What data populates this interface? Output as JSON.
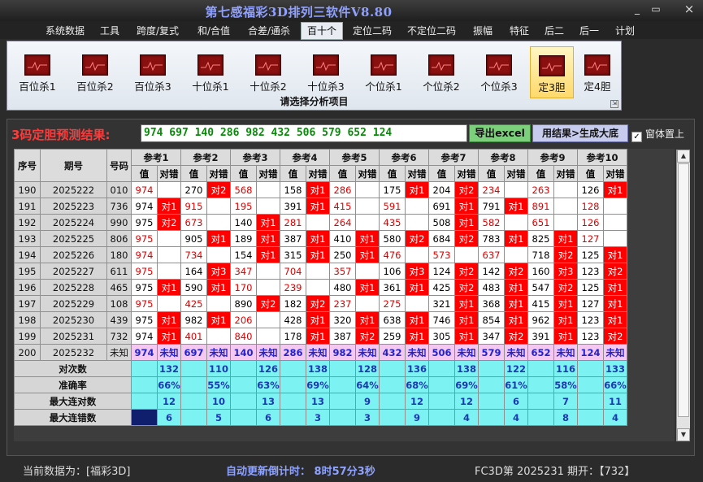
{
  "window": {
    "title": "第七感福彩3D排列三软件V8.80",
    "minimize_icon": "_",
    "restore_icon": "▭",
    "close_icon": "×"
  },
  "menu": [
    {
      "label": "系统数据"
    },
    {
      "label": "工具"
    },
    {
      "label": "跨度/复式"
    },
    {
      "label": "和/合值"
    },
    {
      "label": "合差/通杀"
    },
    {
      "label": "百十个"
    },
    {
      "label": "定位二码"
    },
    {
      "label": "不定位二码"
    },
    {
      "label": "振幅"
    },
    {
      "label": "特征"
    },
    {
      "label": "后二"
    },
    {
      "label": "后一"
    },
    {
      "label": "计划"
    }
  ],
  "ribbon": {
    "tools": [
      {
        "label": "百位杀1"
      },
      {
        "label": "百位杀2"
      },
      {
        "label": "百位杀3"
      },
      {
        "label": "十位杀1"
      },
      {
        "label": "十位杀2"
      },
      {
        "label": "十位杀3"
      },
      {
        "label": "个位杀1"
      },
      {
        "label": "个位杀2"
      },
      {
        "label": "个位杀3"
      },
      {
        "label": "定3胆"
      },
      {
        "label": "定4胆"
      }
    ],
    "caption": "请选择分析项目",
    "corner_icon": "⇲"
  },
  "result": {
    "label": "3码定胆预测结果:",
    "value": "974 697 140 286 982 432 506 579 652 124",
    "export_label": "导出excel",
    "filter_label": "用结果>生成大底",
    "ontop_label": "窗体置上",
    "ontop_mark": "✓"
  },
  "grid": {
    "headers": {
      "seq": "序号",
      "period": "期号",
      "code": "号码",
      "val": "值",
      "hit": "对错"
    },
    "refs": [
      "参考1",
      "参考2",
      "参考3",
      "参考4",
      "参考5",
      "参考6",
      "参考7",
      "参考8",
      "参考9",
      "参考10"
    ],
    "rows": [
      {
        "seq": "190",
        "period": "2025222",
        "code": "010",
        "cells": [
          [
            "974",
            ""
          ],
          [
            "270",
            "对2"
          ],
          [
            "568",
            ""
          ],
          [
            "158",
            "对1"
          ],
          [
            "286",
            ""
          ],
          [
            "175",
            "对1"
          ],
          [
            "204",
            "对2"
          ],
          [
            "234",
            ""
          ],
          [
            "263",
            ""
          ],
          [
            "126",
            "对1"
          ]
        ]
      },
      {
        "seq": "191",
        "period": "2025223",
        "code": "736",
        "cells": [
          [
            "974",
            "对1"
          ],
          [
            "915",
            ""
          ],
          [
            "195",
            ""
          ],
          [
            "391",
            "对1"
          ],
          [
            "415",
            ""
          ],
          [
            "591",
            ""
          ],
          [
            "691",
            "对1"
          ],
          [
            "791",
            "对1"
          ],
          [
            "891",
            ""
          ],
          [
            "128",
            ""
          ]
        ]
      },
      {
        "seq": "192",
        "period": "2025224",
        "code": "990",
        "cells": [
          [
            "975",
            "对2"
          ],
          [
            "673",
            ""
          ],
          [
            "140",
            "对1"
          ],
          [
            "281",
            ""
          ],
          [
            "264",
            ""
          ],
          [
            "435",
            ""
          ],
          [
            "508",
            "对1"
          ],
          [
            "582",
            ""
          ],
          [
            "651",
            ""
          ],
          [
            "126",
            ""
          ]
        ]
      },
      {
        "seq": "193",
        "period": "2025225",
        "code": "806",
        "cells": [
          [
            "975",
            ""
          ],
          [
            "905",
            "对1"
          ],
          [
            "189",
            "对1"
          ],
          [
            "387",
            "对1"
          ],
          [
            "410",
            "对1"
          ],
          [
            "580",
            "对2"
          ],
          [
            "684",
            "对2"
          ],
          [
            "783",
            "对1"
          ],
          [
            "825",
            "对1"
          ],
          [
            "127",
            ""
          ]
        ]
      },
      {
        "seq": "194",
        "period": "2025226",
        "code": "180",
        "cells": [
          [
            "974",
            ""
          ],
          [
            "734",
            ""
          ],
          [
            "154",
            "对1"
          ],
          [
            "315",
            "对1"
          ],
          [
            "250",
            "对1"
          ],
          [
            "476",
            ""
          ],
          [
            "573",
            ""
          ],
          [
            "637",
            ""
          ],
          [
            "718",
            "对2"
          ],
          [
            "125",
            "对1"
          ]
        ]
      },
      {
        "seq": "195",
        "period": "2025227",
        "code": "611",
        "cells": [
          [
            "975",
            ""
          ],
          [
            "164",
            "对3"
          ],
          [
            "347",
            ""
          ],
          [
            "704",
            ""
          ],
          [
            "357",
            ""
          ],
          [
            "106",
            "对3"
          ],
          [
            "124",
            "对2"
          ],
          [
            "142",
            "对2"
          ],
          [
            "160",
            "对3"
          ],
          [
            "123",
            "对2"
          ]
        ]
      },
      {
        "seq": "196",
        "period": "2025228",
        "code": "465",
        "cells": [
          [
            "975",
            "对1"
          ],
          [
            "590",
            "对1"
          ],
          [
            "170",
            ""
          ],
          [
            "239",
            ""
          ],
          [
            "480",
            "对1"
          ],
          [
            "361",
            "对1"
          ],
          [
            "425",
            "对2"
          ],
          [
            "483",
            "对1"
          ],
          [
            "547",
            "对2"
          ],
          [
            "125",
            "对1"
          ]
        ]
      },
      {
        "seq": "197",
        "period": "2025229",
        "code": "108",
        "cells": [
          [
            "975",
            ""
          ],
          [
            "425",
            ""
          ],
          [
            "890",
            "对2"
          ],
          [
            "182",
            "对2"
          ],
          [
            "237",
            ""
          ],
          [
            "275",
            ""
          ],
          [
            "321",
            "对1"
          ],
          [
            "368",
            "对1"
          ],
          [
            "415",
            "对1"
          ],
          [
            "127",
            "对1"
          ]
        ]
      },
      {
        "seq": "198",
        "period": "2025230",
        "code": "439",
        "cells": [
          [
            "975",
            "对1"
          ],
          [
            "982",
            "对1"
          ],
          [
            "206",
            ""
          ],
          [
            "428",
            "对1"
          ],
          [
            "320",
            "对1"
          ],
          [
            "638",
            "对1"
          ],
          [
            "746",
            "对1"
          ],
          [
            "854",
            "对1"
          ],
          [
            "962",
            "对1"
          ],
          [
            "123",
            "对1"
          ]
        ]
      },
      {
        "seq": "199",
        "period": "2025231",
        "code": "732",
        "cells": [
          [
            "974",
            "对1"
          ],
          [
            "401",
            ""
          ],
          [
            "840",
            ""
          ],
          [
            "178",
            "对1"
          ],
          [
            "387",
            "对2"
          ],
          [
            "259",
            "对1"
          ],
          [
            "305",
            "对1"
          ],
          [
            "347",
            "对2"
          ],
          [
            "391",
            "对1"
          ],
          [
            "123",
            "对2"
          ]
        ]
      },
      {
        "seq": "200",
        "period": "2025232",
        "code": "未知",
        "cells": [
          [
            "974",
            "未知"
          ],
          [
            "697",
            "未知"
          ],
          [
            "140",
            "未知"
          ],
          [
            "286",
            "未知"
          ],
          [
            "982",
            "未知"
          ],
          [
            "432",
            "未知"
          ],
          [
            "506",
            "未知"
          ],
          [
            "579",
            "未知"
          ],
          [
            "652",
            "未知"
          ],
          [
            "124",
            "未知"
          ]
        ]
      }
    ],
    "stats": [
      {
        "label": "对次数",
        "values": [
          "132",
          "110",
          "126",
          "138",
          "128",
          "136",
          "138",
          "122",
          "116",
          "133"
        ]
      },
      {
        "label": "准确率",
        "values": [
          "66%",
          "55%",
          "63%",
          "69%",
          "64%",
          "68%",
          "69%",
          "61%",
          "58%",
          "66%"
        ]
      },
      {
        "label": "最大连对数",
        "values": [
          "12",
          "10",
          "13",
          "13",
          "9",
          "12",
          "12",
          "6",
          "7",
          "11"
        ]
      },
      {
        "label": "最大连错数",
        "values": [
          "6",
          "5",
          "6",
          "3",
          "3",
          "9",
          "4",
          "4",
          "8",
          "4"
        ]
      }
    ]
  },
  "status": {
    "left": "当前数据为：[福彩3D]",
    "countdown": "自动更新倒计时：  8时57分3秒",
    "right": "FC3D第 2025231 期开：【732】"
  }
}
